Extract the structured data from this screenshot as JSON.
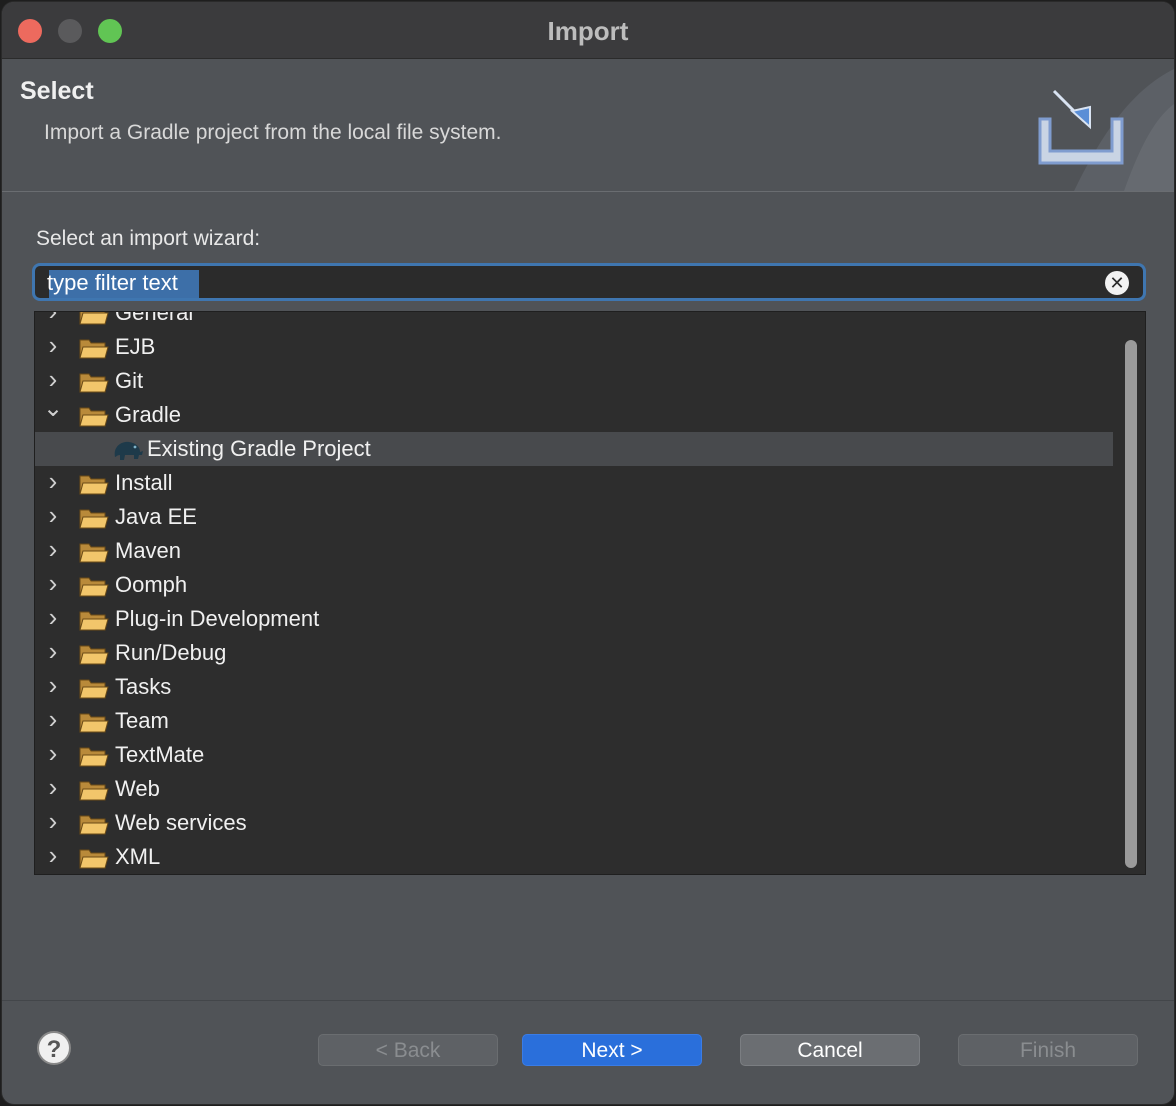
{
  "window": {
    "title": "Import"
  },
  "banner": {
    "title": "Select",
    "description": "Import a Gradle project from the local file system."
  },
  "wizard": {
    "label": "Select an import wizard:",
    "filter_value": "type filter text"
  },
  "tree": {
    "items": [
      {
        "label": "General",
        "expanded": false,
        "icon": "folder-icon"
      },
      {
        "label": "EJB",
        "expanded": false,
        "icon": "folder-icon"
      },
      {
        "label": "Git",
        "expanded": false,
        "icon": "folder-icon"
      },
      {
        "label": "Gradle",
        "expanded": true,
        "icon": "folder-icon"
      },
      {
        "label": "Existing Gradle Project",
        "child": true,
        "selected": true,
        "icon": "gradle-elephant-icon"
      },
      {
        "label": "Install",
        "expanded": false,
        "icon": "folder-icon"
      },
      {
        "label": "Java EE",
        "expanded": false,
        "icon": "folder-icon"
      },
      {
        "label": "Maven",
        "expanded": false,
        "icon": "folder-icon"
      },
      {
        "label": "Oomph",
        "expanded": false,
        "icon": "folder-icon"
      },
      {
        "label": "Plug-in Development",
        "expanded": false,
        "icon": "folder-icon"
      },
      {
        "label": "Run/Debug",
        "expanded": false,
        "icon": "folder-icon"
      },
      {
        "label": "Tasks",
        "expanded": false,
        "icon": "folder-icon"
      },
      {
        "label": "Team",
        "expanded": false,
        "icon": "folder-icon"
      },
      {
        "label": "TextMate",
        "expanded": false,
        "icon": "folder-icon"
      },
      {
        "label": "Web",
        "expanded": false,
        "icon": "folder-icon"
      },
      {
        "label": "Web services",
        "expanded": false,
        "icon": "folder-icon"
      },
      {
        "label": "XML",
        "expanded": false,
        "icon": "folder-icon"
      }
    ]
  },
  "buttons": {
    "help": "?",
    "back": "< Back",
    "next": "Next >",
    "cancel": "Cancel",
    "finish": "Finish"
  },
  "colors": {
    "accent": "#2a6fdb",
    "focus_ring": "#3f76b0",
    "window_bg": "#505357",
    "tree_bg": "#2d2d2d"
  }
}
